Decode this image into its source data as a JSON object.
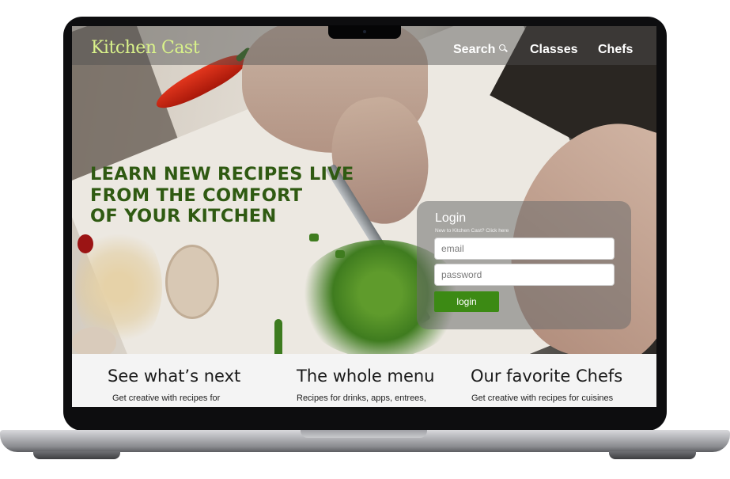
{
  "nav": {
    "logo": "Kitchen Cast",
    "items": [
      {
        "label": "Search",
        "icon": "search-icon"
      },
      {
        "label": "Classes"
      },
      {
        "label": "Chefs"
      }
    ]
  },
  "hero": {
    "headline_lines": [
      "LEARN NEW RECIPES LIVE",
      "FROM THE COMFORT",
      "OF YOUR KITCHEN"
    ]
  },
  "login": {
    "title": "Login",
    "subtitle": "New to Kitchen Cast? Click here",
    "email_placeholder": "email",
    "password_placeholder": "password",
    "button_label": "login"
  },
  "features": [
    {
      "title": "See what’s next",
      "text": "Get creative with recipes for"
    },
    {
      "title": "The whole menu",
      "text": "Recipes for drinks, apps, entrees,"
    },
    {
      "title": "Our favorite Chefs",
      "text": "Get creative with recipes for cuisines"
    }
  ],
  "colors": {
    "logo": "#d9f28a",
    "headline": "#2f5a12",
    "login_button": "#3c8a14"
  }
}
